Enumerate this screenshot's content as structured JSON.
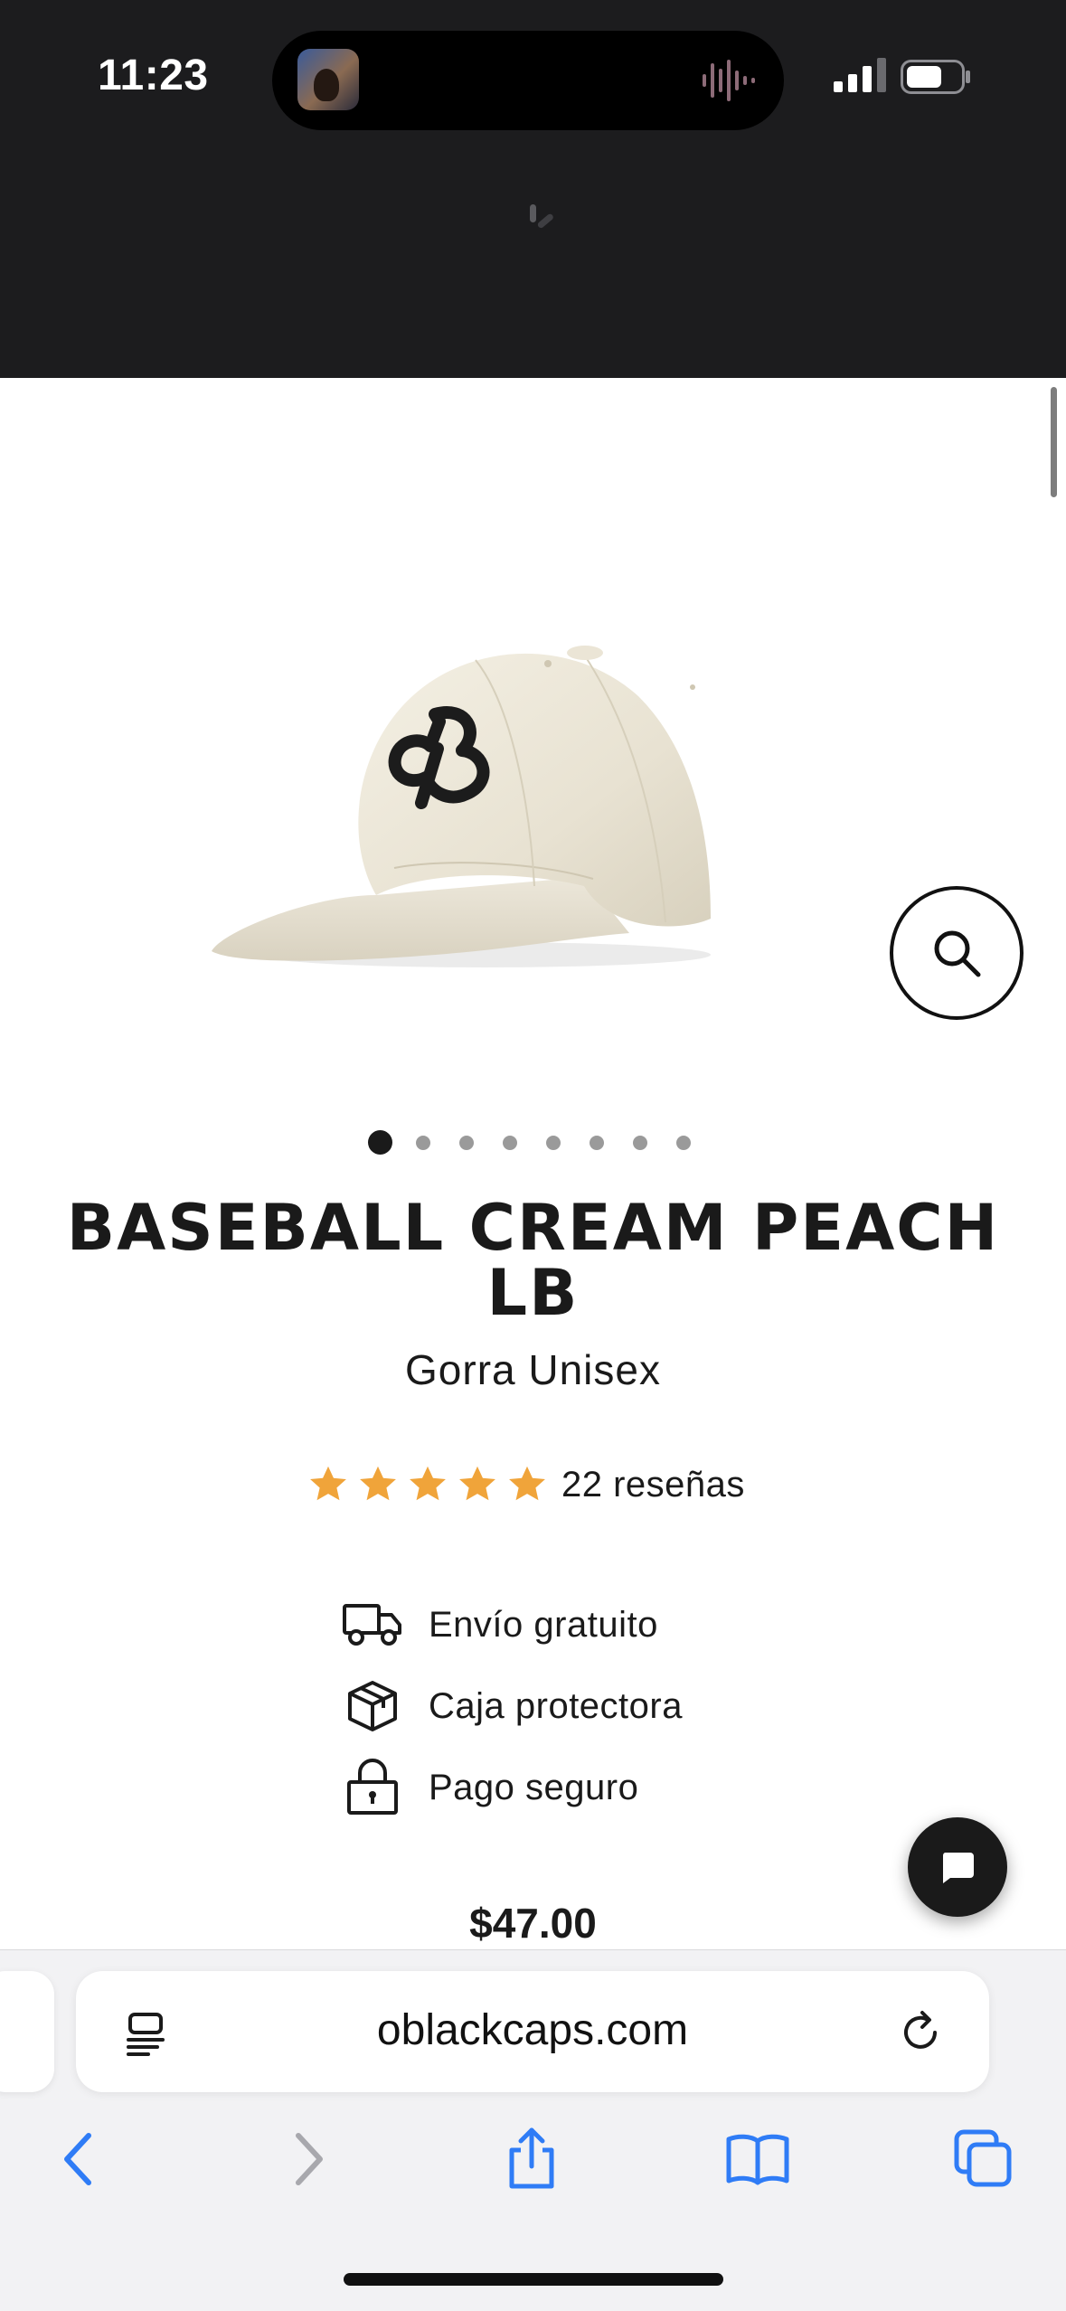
{
  "status_bar": {
    "time": "11:23",
    "icons": [
      "now-playing-art",
      "audio-waveform-icon",
      "cellular-signal-icon",
      "battery-icon"
    ]
  },
  "product": {
    "title": "BASEBALL CREAM PEACH LB",
    "subtitle": "Gorra Unisex",
    "rating_stars": 5,
    "rating_max": 5,
    "reviews_text": "22 reseñas",
    "price": "$47.00",
    "image_count": 8,
    "active_image_index": 0,
    "star_color": "#f0a43a"
  },
  "features": [
    {
      "icon": "truck-icon",
      "label": "Envío gratuito"
    },
    {
      "icon": "box-icon",
      "label": "Caja protectora"
    },
    {
      "icon": "lock-icon",
      "label": "Pago seguro"
    }
  ],
  "browser": {
    "url": "oblackcaps.com",
    "toolbar": [
      "back-icon",
      "forward-icon",
      "share-icon",
      "bookmarks-icon",
      "tabs-icon"
    ],
    "accent": "#2f7cf6"
  }
}
